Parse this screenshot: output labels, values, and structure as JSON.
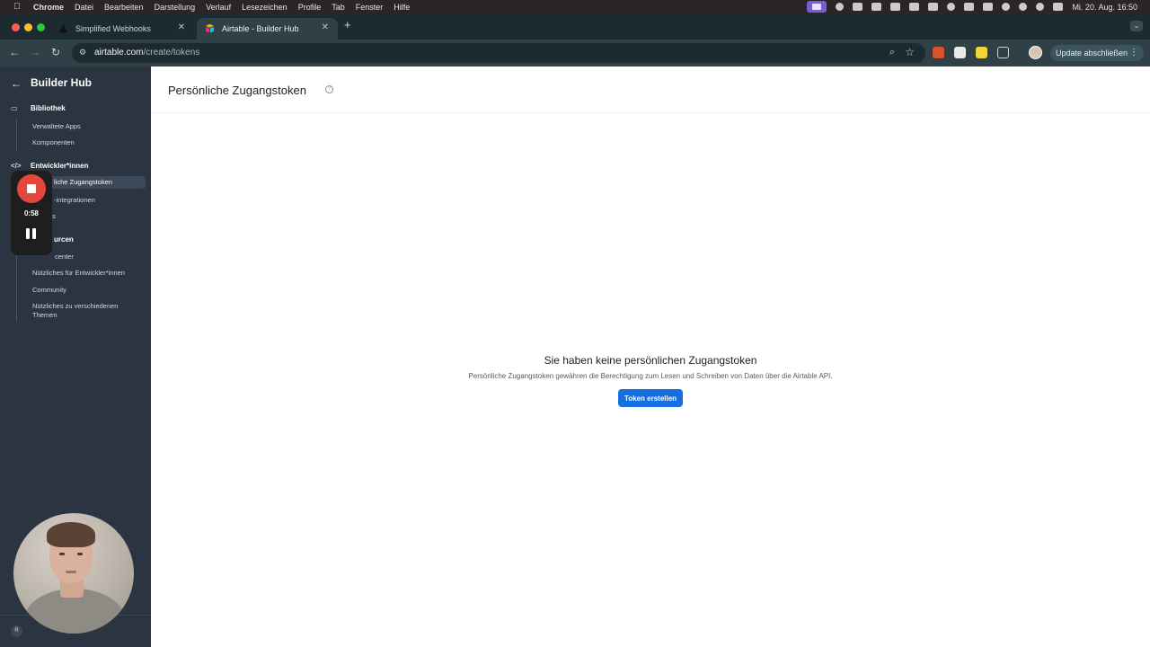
{
  "menubar": {
    "app_name": "Chrome",
    "items": [
      "Datei",
      "Bearbeiten",
      "Darstellung",
      "Verlauf",
      "Lesezeichen",
      "Profile",
      "Tab",
      "Fenster",
      "Hilfe"
    ],
    "clock": "Mi. 20. Aug.  16:50"
  },
  "browser": {
    "tabs": [
      {
        "title": "Simplified Webhooks",
        "active": false
      },
      {
        "title": "Airtable - Builder Hub",
        "active": true
      }
    ],
    "url_host": "airtable.com",
    "url_path": "/create/tokens",
    "update_label": "Update abschließen"
  },
  "sidebar": {
    "title": "Builder Hub",
    "sections": [
      {
        "label": "Bibliothek",
        "items": [
          "Verwaltete Apps",
          "Komponenten"
        ]
      },
      {
        "label": "Entwickler*innen",
        "items": [
          "Persönliche Zugangstoken",
          "OAuth-Integrationen",
          "Webhooks"
        ]
      },
      {
        "label": "Ressourcen",
        "items": [
          "Hilfecenter",
          "Nützliches für Entwickler*innen",
          "Community",
          "Nützliches zu verschiedenen Themen"
        ]
      }
    ],
    "visible": {
      "section2_label": "Entwickler*innen",
      "section3_label": "urcen",
      "item_active": "liche Zugangstoken",
      "item_oauth": "-integrationen",
      "item_webhooks": "s",
      "item_help": "center",
      "item_dev": "Nützliches für Entwickler*innen",
      "item_community": "Community",
      "item_topics": "Nützliches zu verschiedenen Themen"
    },
    "user_initial": "R"
  },
  "recorder": {
    "time": "0:58"
  },
  "main": {
    "page_title": "Persönliche Zugangstoken",
    "empty_title": "Sie haben keine persönlichen Zugangstoken",
    "empty_description": "Persönliche Zugangstoken gewähren die Berechtigung zum Lesen und Schreiben von Daten über die Airtable API.",
    "create_button": "Token erstellen"
  },
  "colors": {
    "accent": "#166ee1",
    "sidebar_bg": "#2b3441",
    "record": "#e5473a"
  }
}
